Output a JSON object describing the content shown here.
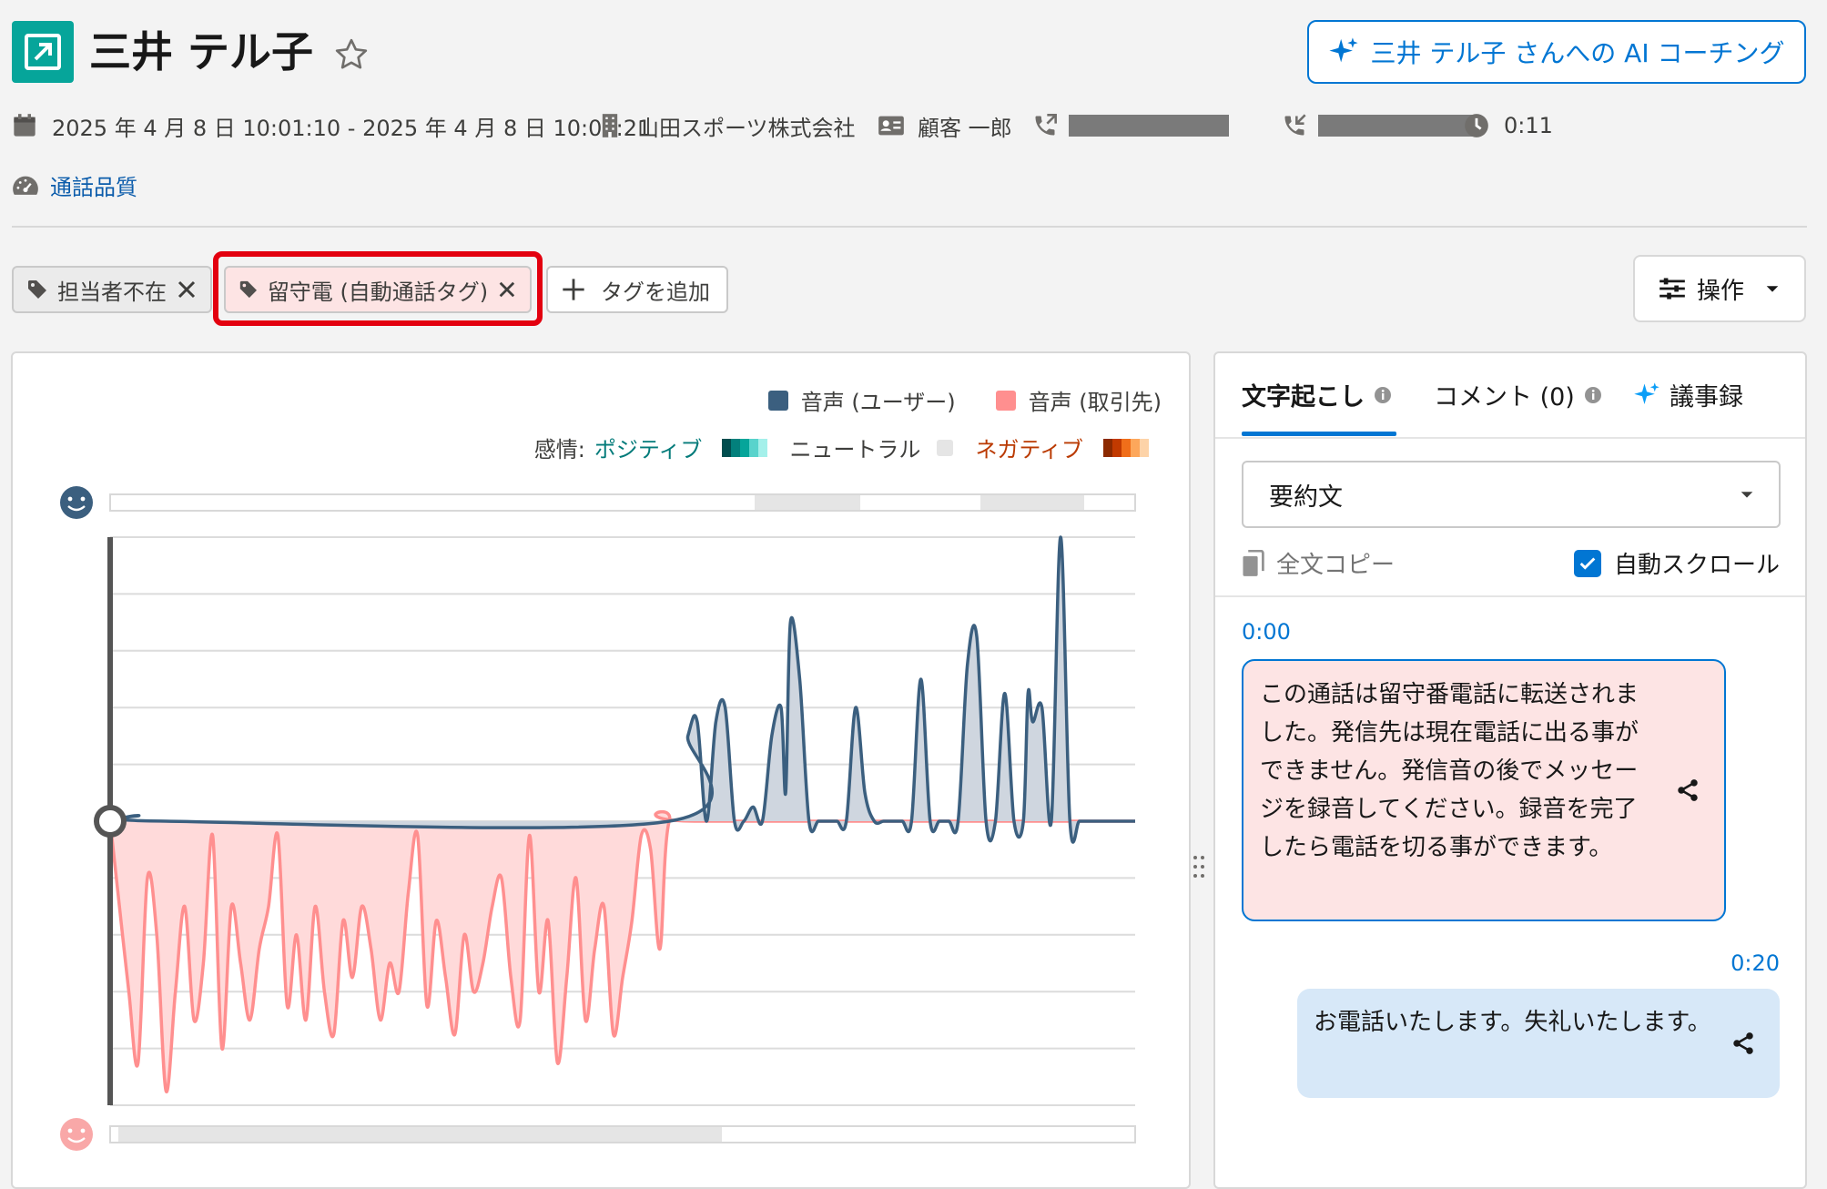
{
  "header": {
    "title": "三井 テル子",
    "ai_coaching_label": "三井 テル子 さんへの AI コーチング"
  },
  "meta": {
    "datetime_range": "2025 年 4 月 8 日 10:01:10 - 2025 年 4 月 8 日 10:01:21",
    "company": "山田スポーツ株式会社",
    "contact": "顧客 一郎",
    "duration": "0:11",
    "call_quality_link": "通話品質"
  },
  "tags": [
    {
      "label": "担当者不在"
    },
    {
      "label": "留守電 (自動通話タグ)"
    }
  ],
  "add_tag_label": "タグを追加",
  "operations_label": "操作",
  "legend": {
    "user_label": "音声 (ユーザー)",
    "client_label": "音声 (取引先)",
    "sentiment_prefix": "感情:",
    "positive": "ポジティブ",
    "neutral": "ニュートラル",
    "negative": "ネガティブ"
  },
  "colors": {
    "brand": "#0176d3",
    "user_voice": "#3b5f7f",
    "client_voice": "#ff8f8f",
    "tag_highlight": "#e3000f"
  },
  "chart_data": {
    "type": "area",
    "x_range": [
      0,
      11
    ],
    "ylim": [
      -1,
      1
    ],
    "grid": true,
    "series": [
      {
        "name": "音声 (ユーザー)",
        "x": [
          0.0,
          0.3,
          0.6,
          6.0,
          6.2,
          6.3,
          6.4,
          6.5,
          6.6,
          6.7,
          6.8,
          6.9,
          7.0,
          7.1,
          7.2,
          7.25,
          7.3,
          7.4,
          7.5,
          7.6,
          7.7,
          7.8,
          7.9,
          8.0,
          8.1,
          8.2,
          8.3,
          8.4,
          8.5,
          8.6,
          8.7,
          8.8,
          8.9,
          9.0,
          9.1,
          9.2,
          9.3,
          9.4,
          9.5,
          9.6,
          9.7,
          9.8,
          9.85,
          9.9,
          10.0,
          10.1,
          10.2,
          10.3,
          10.4,
          10.5,
          10.6,
          10.7,
          10.8,
          10.9,
          11.0
        ],
        "values": [
          0.0,
          0.02,
          0.0,
          0.0,
          0.3,
          0.35,
          0.0,
          0.35,
          0.4,
          0.0,
          0.0,
          0.05,
          0.0,
          0.3,
          0.4,
          0.1,
          0.7,
          0.5,
          0.0,
          0.0,
          0.0,
          0.0,
          0.0,
          0.4,
          0.1,
          0.0,
          0.0,
          0.0,
          0.0,
          0.0,
          0.5,
          0.0,
          0.0,
          0.0,
          0.0,
          0.55,
          0.65,
          0.0,
          0.0,
          0.45,
          0.0,
          0.0,
          0.45,
          0.35,
          0.4,
          0.0,
          1.0,
          0.0,
          0.0,
          0.0,
          0.0,
          0.0,
          0.0,
          0.0,
          0.0
        ]
      },
      {
        "name": "音声 (取引先)",
        "x": [
          0.0,
          0.1,
          0.2,
          0.3,
          0.4,
          0.5,
          0.6,
          0.7,
          0.8,
          0.9,
          1.0,
          1.1,
          1.2,
          1.3,
          1.4,
          1.5,
          1.6,
          1.7,
          1.8,
          1.9,
          2.0,
          2.1,
          2.2,
          2.3,
          2.4,
          2.5,
          2.6,
          2.7,
          2.8,
          2.9,
          3.0,
          3.1,
          3.2,
          3.3,
          3.4,
          3.5,
          3.6,
          3.7,
          3.8,
          3.9,
          4.0,
          4.1,
          4.2,
          4.3,
          4.4,
          4.5,
          4.6,
          4.7,
          4.8,
          4.9,
          5.0,
          5.1,
          5.2,
          5.3,
          5.4,
          5.5,
          5.6,
          5.7,
          5.8,
          5.9,
          6.0,
          6.3,
          11.0
        ],
        "values": [
          0.0,
          -0.3,
          -0.6,
          -0.85,
          -0.2,
          -0.4,
          -0.95,
          -0.6,
          -0.3,
          -0.7,
          -0.5,
          -0.05,
          -0.8,
          -0.3,
          -0.5,
          -0.7,
          -0.45,
          -0.3,
          -0.05,
          -0.65,
          -0.4,
          -0.7,
          -0.3,
          -0.6,
          -0.75,
          -0.35,
          -0.55,
          -0.3,
          -0.45,
          -0.7,
          -0.5,
          -0.6,
          -0.25,
          -0.05,
          -0.65,
          -0.35,
          -0.55,
          -0.75,
          -0.4,
          -0.6,
          -0.5,
          -0.3,
          -0.2,
          -0.55,
          -0.7,
          -0.05,
          -0.6,
          -0.35,
          -0.85,
          -0.55,
          -0.2,
          -0.7,
          -0.45,
          -0.3,
          -0.75,
          -0.55,
          -0.35,
          -0.05,
          -0.1,
          -0.45,
          0.0,
          0.0,
          0.0
        ]
      }
    ]
  },
  "right_panel": {
    "tabs": [
      {
        "label": "文字起こし"
      },
      {
        "label": "コメント (0)"
      },
      {
        "label": "議事録"
      }
    ],
    "select_value": "要約文",
    "copy_all_label": "全文コピー",
    "auto_scroll_label": "自動スクロール",
    "messages": [
      {
        "time": "0:00",
        "text": "この通話は留守番電話に転送されました。発信先は現在電話に出る事ができません。発信音の後でメッセージを録音してください。録音を完了したら電話を切る事ができます。"
      },
      {
        "time": "0:20",
        "text": "お電話いたします。失礼いたします。"
      }
    ]
  }
}
